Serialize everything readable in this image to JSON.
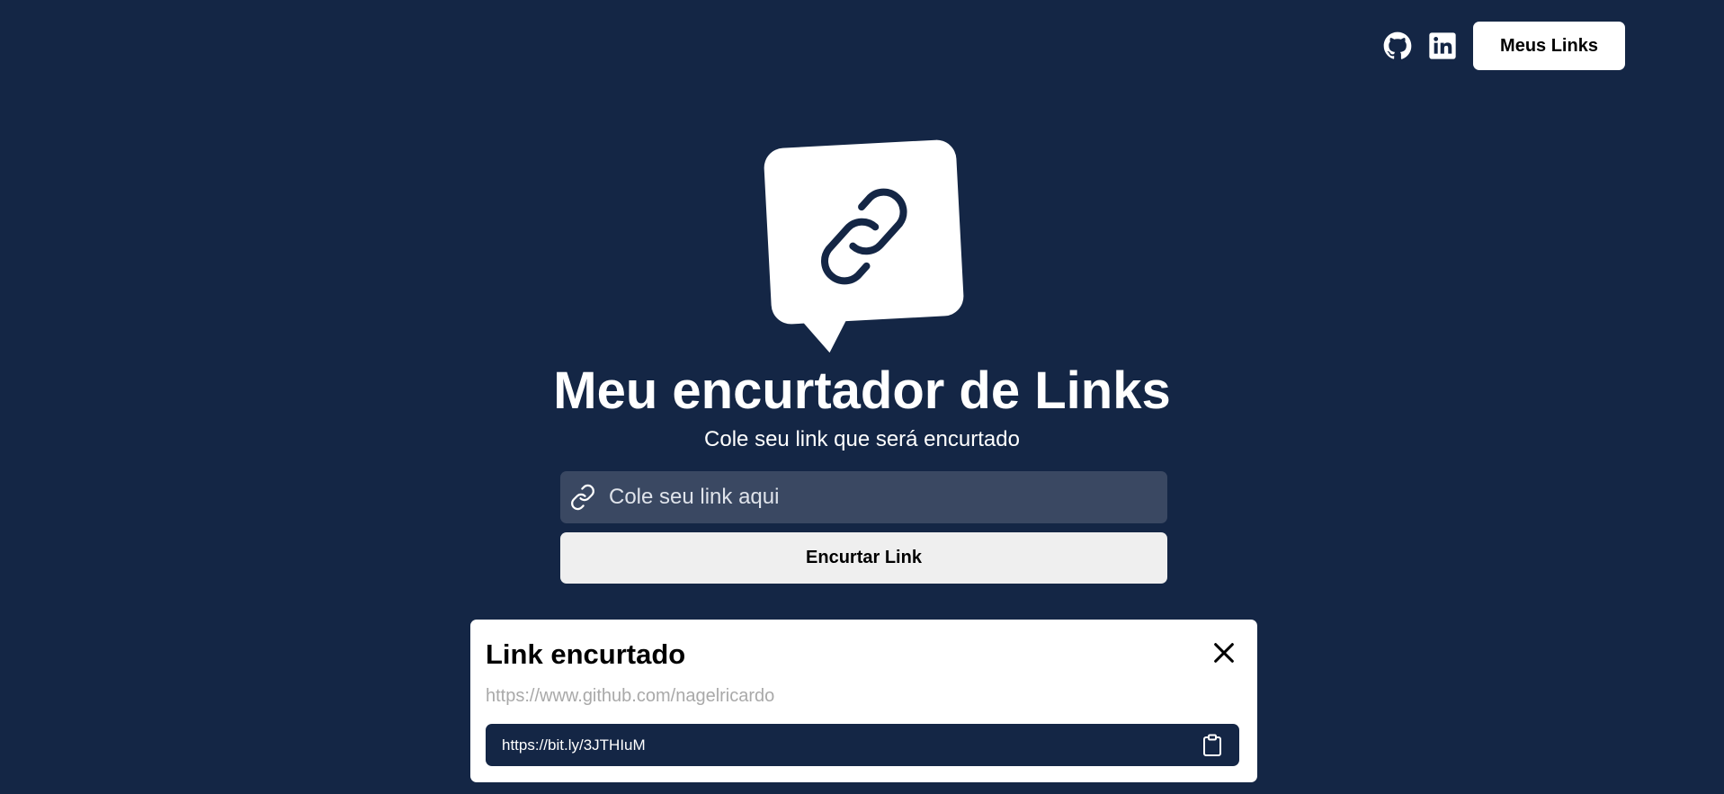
{
  "header": {
    "github_icon": "github-icon",
    "linkedin_icon": "linkedin-icon",
    "my_links_label": "Meus Links"
  },
  "hero": {
    "logo_icon": "link-chat-bubble-icon",
    "title": "Meu encurtador de Links",
    "subtitle": "Cole seu link que será encurtado"
  },
  "form": {
    "input_placeholder": "Cole seu link aqui",
    "input_value": "",
    "submit_label": "Encurtar Link"
  },
  "result": {
    "title": "Link encurtado",
    "original_url": "https://www.github.com/nagelricardo",
    "short_url": "https://bit.ly/3JTHIuM"
  },
  "colors": {
    "background": "#142645",
    "input_background": "#3a4862",
    "button_background": "#efefef",
    "card_background": "#ffffff",
    "muted_text": "#a9a9a9"
  }
}
